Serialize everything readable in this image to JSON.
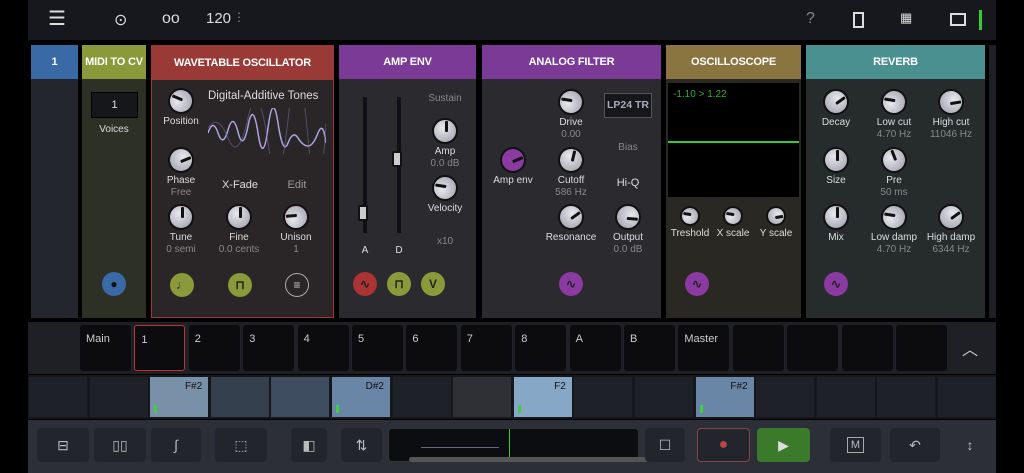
{
  "topbar": {
    "tempo": "120",
    "help": "?",
    "icons": [
      "menu-icon",
      "link-icon",
      "tape-icon",
      "help-icon",
      "phone-icon",
      "grid-icon",
      "window-icon",
      "level-meter-icon"
    ]
  },
  "track_label": "1",
  "modules": {
    "midi": {
      "title": "MIDI TO CV",
      "voices_value": "1",
      "voices_label": "Voices",
      "color": "#8a9a3a"
    },
    "wavetable": {
      "title": "WAVETABLE OSCILLATOR",
      "color": "#9a3a36",
      "table_name": "Digital-Additive Tones",
      "xfade": "X-Fade",
      "edit": "Edit"
    },
    "ampenv": {
      "title": "AMP ENV",
      "color": "#7a3a96",
      "sustain": "Sustain",
      "a": "A",
      "d": "D",
      "x10": "x10",
      "v_btn": "V",
      "a_level": 0.1,
      "d_level": 0.55
    },
    "filter": {
      "title": "ANALOG FILTER",
      "color": "#7a3a96",
      "mode": "LP24 TR",
      "bias": "Bias",
      "hiq": "Hi-Q"
    },
    "scope": {
      "title": "OSCILLOSCOPE",
      "color": "#8a7440",
      "readout": "-1.10 > 1.22"
    },
    "reverb": {
      "title": "REVERB",
      "color": "#4a9090"
    }
  },
  "knobs": [
    {
      "label": "Position",
      "value": "",
      "level": 0.25
    },
    {
      "label": "Phase",
      "value": "Free",
      "level": 0.75
    },
    {
      "label": "Tune",
      "value": "0 semi",
      "level": 0.5
    },
    {
      "label": "Fine",
      "value": "0.0 cents",
      "level": 0.5
    },
    {
      "label": "Unison",
      "value": "1",
      "level": 0.15
    },
    {
      "label": "Amp",
      "value": "0.0 dB",
      "level": 0.5
    },
    {
      "label": "Velocity",
      "value": "",
      "level": 0.2
    },
    {
      "label": "Amp env",
      "value": "",
      "level": 0.75
    },
    {
      "label": "Drive",
      "value": "0.00",
      "level": 0.2
    },
    {
      "label": "Cutoff",
      "value": "586 Hz",
      "level": 0.55
    },
    {
      "label": "Resonance",
      "value": "",
      "level": 0.7
    },
    {
      "label": "Output",
      "value": "0.0 dB",
      "level": 0.85
    },
    {
      "label": "Treshold",
      "value": "",
      "level": 0.2
    },
    {
      "label": "X scale",
      "value": "",
      "level": 0.2
    },
    {
      "label": "Y scale",
      "value": "",
      "level": 0.8
    },
    {
      "label": "Decay",
      "value": "",
      "level": 0.7
    },
    {
      "label": "Low cut",
      "value": "4.70 Hz",
      "level": 0.2
    },
    {
      "label": "High cut",
      "value": "11046 Hz",
      "level": 0.8
    },
    {
      "label": "Size",
      "value": "",
      "level": 0.5
    },
    {
      "label": "Pre",
      "value": "50 ms",
      "level": 0.42
    },
    {
      "label": "Mix",
      "value": "",
      "level": 0.5
    },
    {
      "label": "Low damp",
      "value": "4.70 Hz",
      "level": 0.2
    },
    {
      "label": "High damp",
      "value": "6344 Hz",
      "level": 0.7
    }
  ],
  "tracks": [
    "Main",
    "1",
    "2",
    "3",
    "4",
    "5",
    "6",
    "7",
    "8",
    "A",
    "B",
    "Master",
    "",
    "",
    "",
    ""
  ],
  "patterns": [
    "",
    "",
    "F#2",
    "",
    "",
    "D#2",
    "",
    "",
    "F2",
    "",
    "",
    "F#2",
    "",
    "",
    "",
    ""
  ],
  "toolbar": {
    "m_label": "M"
  }
}
